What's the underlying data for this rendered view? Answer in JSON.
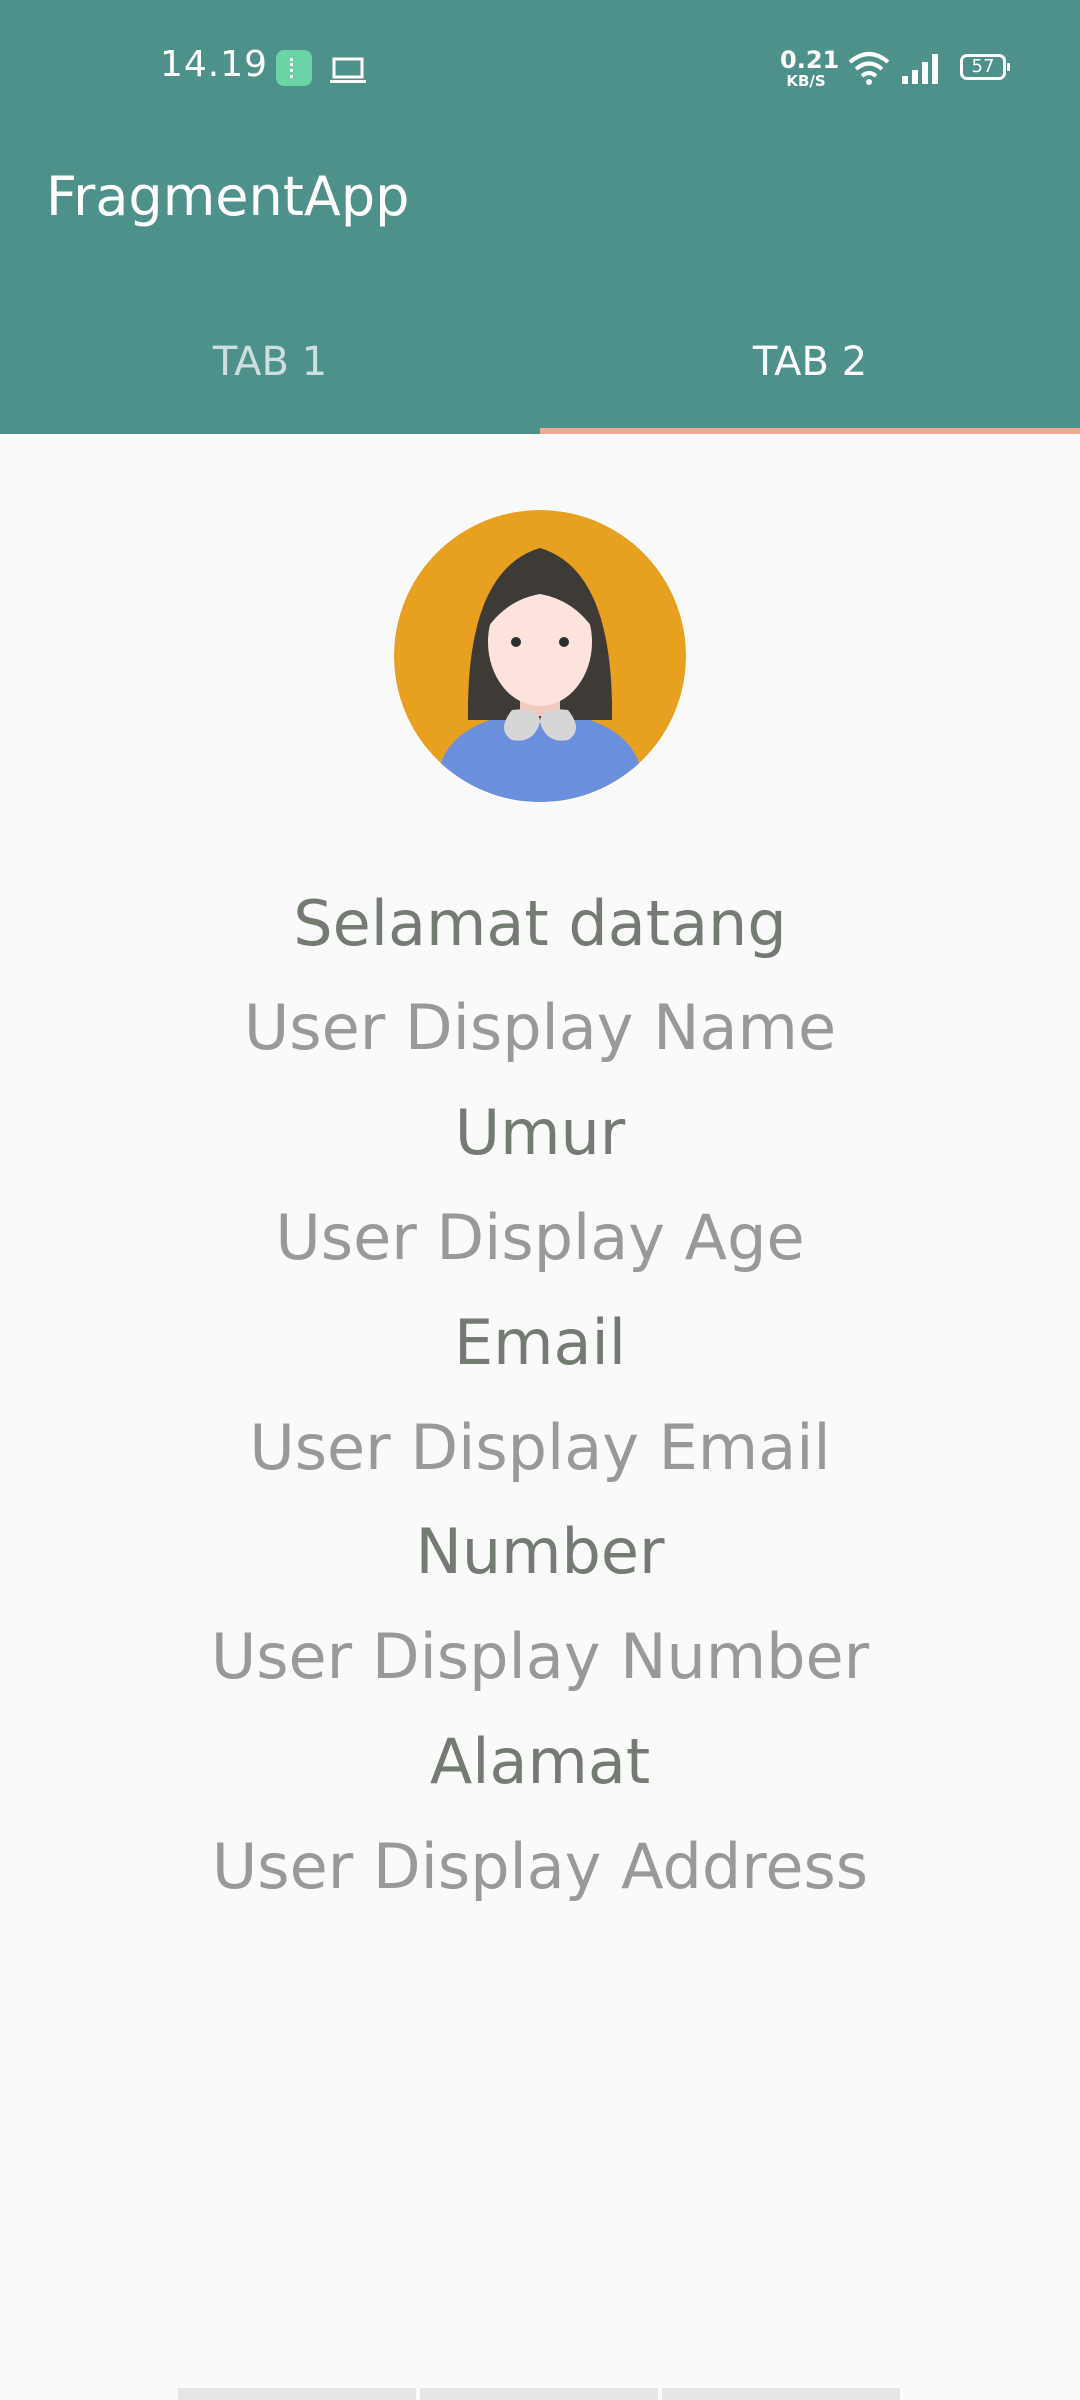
{
  "status_bar": {
    "time": "14.19",
    "net_speed_value": "0.21",
    "net_speed_unit": "KB/S",
    "battery": "57"
  },
  "toolbar": {
    "title": "FragmentApp"
  },
  "tabs": [
    {
      "label": "TAB 1",
      "selected": false
    },
    {
      "label": "TAB 2",
      "selected": true
    }
  ],
  "colors": {
    "primary": "#4e918b",
    "tab_indicator": "#f0a897",
    "label_text": "#737b72",
    "value_text": "#999999",
    "avatar_background": "#e8a020",
    "avatar_shirt": "#6a8fdd"
  },
  "profile": {
    "avatar_icon": "user-avatar-female",
    "welcome_label": "Selamat datang",
    "name_value": "User Display Name",
    "age_label": "Umur",
    "age_value": "User Display Age",
    "email_label": "Email",
    "email_value": "User Display Email",
    "number_label": "Number",
    "number_value": "User Display Number",
    "address_label": "Alamat",
    "address_value": "User Display Address"
  }
}
